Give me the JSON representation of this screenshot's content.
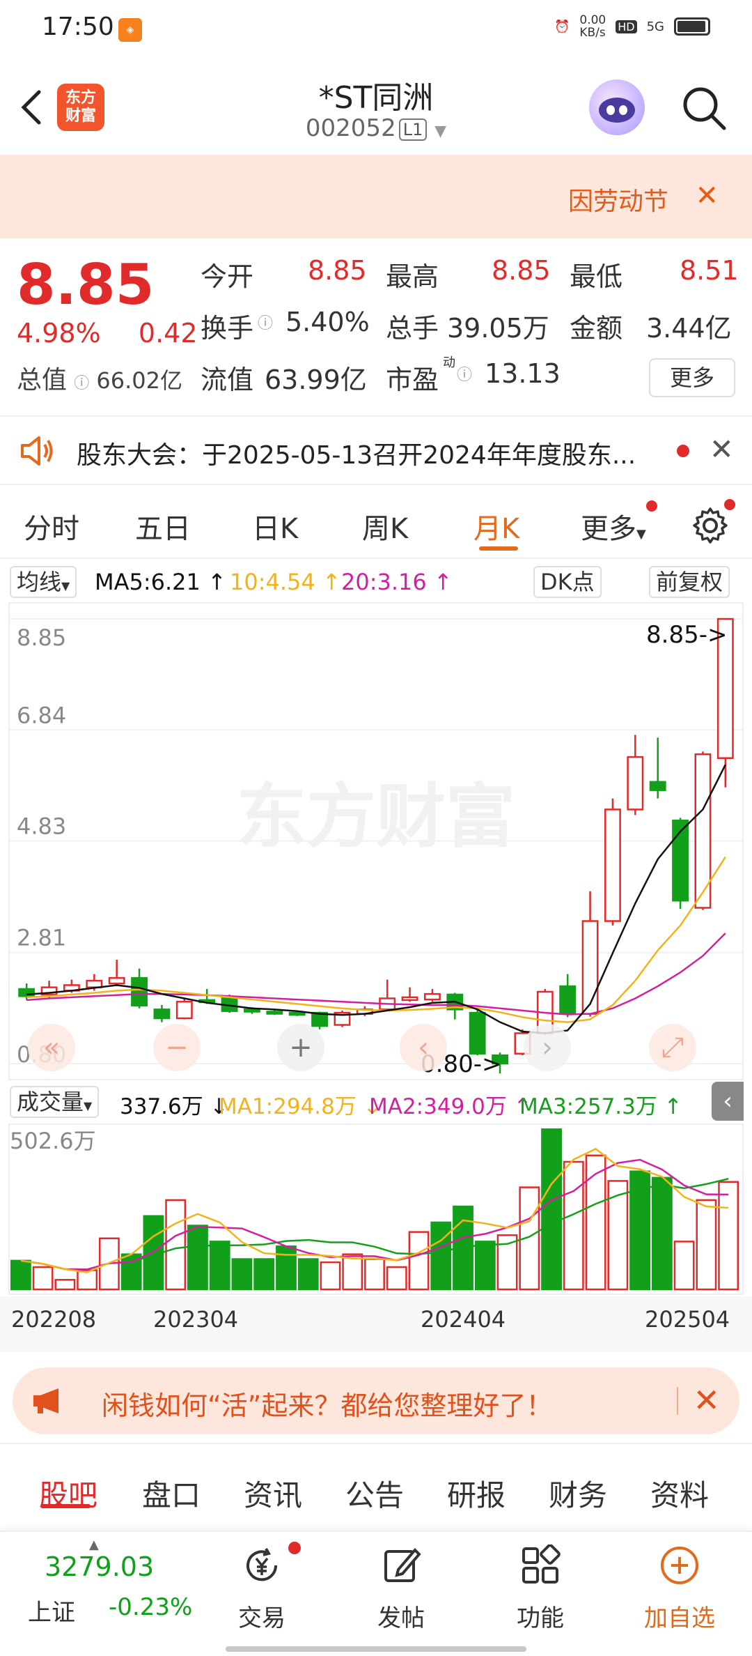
{
  "status": {
    "time": "17:50",
    "net": "0.00\nKB/s",
    "hd": "HD",
    "sig": "5G"
  },
  "header": {
    "title": "*ST同洲",
    "code": "002052",
    "code_badge": "L1",
    "logo": "东方\n财富"
  },
  "banner": {
    "text": "因劳动节"
  },
  "quote": {
    "price": "8.85",
    "change_pct": "4.98%",
    "change_abs": "0.42",
    "total_value_label": "总值",
    "total_value": "66.02亿",
    "rows": [
      [
        {
          "label": "今开",
          "value": "8.85",
          "red": true
        },
        {
          "label": "最高",
          "value": "8.85",
          "red": true
        },
        {
          "label": "最低",
          "value": "8.51",
          "red": true
        }
      ],
      [
        {
          "label": "换手",
          "value": "5.40%"
        },
        {
          "label": "总手",
          "value": "39.05万"
        },
        {
          "label": "金额",
          "value": "3.44亿"
        }
      ],
      [
        {
          "label": "流值",
          "value": "63.99亿"
        },
        {
          "label": "市盈",
          "value": "13.13"
        }
      ]
    ],
    "more_label": "更多",
    "pe_superscript": "动"
  },
  "notice": {
    "text": "股东大会：于2025-05-13召开2024年年度股东..."
  },
  "tabs": [
    "分时",
    "五日",
    "日K",
    "周K",
    "月K",
    "更多"
  ],
  "active_tab": "月K",
  "ma": {
    "chip": "均线",
    "ma5": "MA5:6.21 ↑",
    "ma10": "10:4.54 ↑",
    "ma20": "20:3.16 ↑",
    "dk": "DK点",
    "adjust": "前复权"
  },
  "colors": {
    "up": "#e12b2b",
    "down": "#12a01b",
    "ma5": "#111111",
    "ma10": "#f2b21a",
    "ma20": "#d21fa0",
    "accent": "#e26a1c"
  },
  "chart_data": {
    "type": "candlestick",
    "title": "",
    "y_ticks": [
      "8.85",
      "6.84",
      "4.83",
      "2.81",
      "0.80"
    ],
    "ylim": [
      0.8,
      8.85
    ],
    "last_label": "8.85->",
    "low_label": "0.80->",
    "candles": [
      {
        "o": 2.15,
        "c": 2.02,
        "h": 2.25,
        "l": 1.95
      },
      {
        "o": 2.05,
        "c": 2.18,
        "h": 2.3,
        "l": 1.98
      },
      {
        "o": 2.12,
        "c": 2.22,
        "h": 2.32,
        "l": 2.08
      },
      {
        "o": 2.18,
        "c": 2.3,
        "h": 2.42,
        "l": 2.12
      },
      {
        "o": 2.25,
        "c": 2.35,
        "h": 2.68,
        "l": 2.2
      },
      {
        "o": 2.35,
        "c": 1.85,
        "h": 2.52,
        "l": 1.8
      },
      {
        "o": 1.78,
        "c": 1.62,
        "h": 1.86,
        "l": 1.55
      },
      {
        "o": 1.62,
        "c": 1.92,
        "h": 1.98,
        "l": 1.6
      },
      {
        "o": 1.95,
        "c": 1.93,
        "h": 2.15,
        "l": 1.88
      },
      {
        "o": 1.98,
        "c": 1.75,
        "h": 2.05,
        "l": 1.72
      },
      {
        "o": 1.78,
        "c": 1.74,
        "h": 1.82,
        "l": 1.7
      },
      {
        "o": 1.74,
        "c": 1.72,
        "h": 1.78,
        "l": 1.68
      },
      {
        "o": 1.72,
        "c": 1.7,
        "h": 1.76,
        "l": 1.66
      },
      {
        "o": 1.72,
        "c": 1.48,
        "h": 1.74,
        "l": 1.42
      },
      {
        "o": 1.5,
        "c": 1.72,
        "h": 1.76,
        "l": 1.46
      },
      {
        "o": 1.7,
        "c": 1.78,
        "h": 1.84,
        "l": 1.66
      },
      {
        "o": 1.78,
        "c": 1.98,
        "h": 2.32,
        "l": 1.75
      },
      {
        "o": 1.95,
        "c": 2.0,
        "h": 2.18,
        "l": 1.92
      },
      {
        "o": 1.96,
        "c": 2.06,
        "h": 2.15,
        "l": 1.92
      },
      {
        "o": 2.05,
        "c": 1.78,
        "h": 2.08,
        "l": 1.6
      },
      {
        "o": 1.72,
        "c": 0.98,
        "h": 1.78,
        "l": 0.95
      },
      {
        "o": 0.95,
        "c": 0.8,
        "h": 1.0,
        "l": 0.62
      },
      {
        "o": 0.98,
        "c": 1.35,
        "h": 1.42,
        "l": 0.95
      },
      {
        "o": 1.35,
        "c": 2.1,
        "h": 2.15,
        "l": 1.32
      },
      {
        "o": 2.2,
        "c": 1.7,
        "h": 2.42,
        "l": 1.64
      },
      {
        "o": 1.7,
        "c": 3.38,
        "h": 3.92,
        "l": 1.65
      },
      {
        "o": 3.38,
        "c": 5.4,
        "h": 5.6,
        "l": 3.3
      },
      {
        "o": 5.4,
        "c": 6.35,
        "h": 6.75,
        "l": 5.3
      },
      {
        "o": 5.9,
        "c": 5.75,
        "h": 6.7,
        "l": 5.6
      },
      {
        "o": 5.2,
        "c": 3.75,
        "h": 5.25,
        "l": 3.6
      },
      {
        "o": 3.62,
        "c": 6.4,
        "h": 6.45,
        "l": 3.58
      },
      {
        "o": 6.33,
        "c": 8.85,
        "h": 8.85,
        "l": 5.8
      }
    ],
    "ma5": [
      2.05,
      2.08,
      2.12,
      2.17,
      2.22,
      2.17,
      2.06,
      1.98,
      1.9,
      1.85,
      1.8,
      1.78,
      1.75,
      1.7,
      1.68,
      1.7,
      1.76,
      1.82,
      1.9,
      1.92,
      1.78,
      1.55,
      1.38,
      1.35,
      1.4,
      1.88,
      2.8,
      3.7,
      4.5,
      5.0,
      5.4,
      6.21
    ],
    "ma10": [
      2.0,
      2.02,
      2.05,
      2.08,
      2.12,
      2.14,
      2.12,
      2.08,
      2.04,
      2.0,
      1.96,
      1.92,
      1.88,
      1.84,
      1.8,
      1.77,
      1.76,
      1.77,
      1.79,
      1.82,
      1.8,
      1.73,
      1.64,
      1.58,
      1.55,
      1.6,
      1.86,
      2.3,
      2.85,
      3.3,
      3.9,
      4.54
    ],
    "ma20": [
      1.95,
      1.98,
      2.0,
      2.02,
      2.04,
      2.06,
      2.06,
      2.05,
      2.04,
      2.02,
      2.0,
      1.98,
      1.96,
      1.94,
      1.92,
      1.9,
      1.88,
      1.87,
      1.86,
      1.86,
      1.84,
      1.8,
      1.76,
      1.72,
      1.69,
      1.7,
      1.8,
      1.98,
      2.2,
      2.45,
      2.75,
      3.16
    ]
  },
  "volume": {
    "chip": "成交量",
    "value": "337.6万 ↓",
    "ma1": "MA1:294.8万 ↓",
    "ma2": "MA2:349.0万 ↑",
    "ma3": "MA3:257.3万 ↑",
    "max_label": "502.6万",
    "ymax": 502.6,
    "bars": [
      90,
      70,
      30,
      60,
      160,
      110,
      230,
      280,
      200,
      150,
      95,
      95,
      135,
      95,
      85,
      110,
      95,
      70,
      180,
      210,
      260,
      150,
      170,
      320,
      502,
      400,
      420,
      340,
      370,
      350,
      150,
      280,
      337
    ]
  },
  "dates": [
    "202208",
    "202304",
    "202404",
    "202504"
  ],
  "chart_controls": {
    "rewind": "«",
    "zoom_out": "−",
    "zoom_in": "+",
    "prev": "‹",
    "next": "›",
    "fullscreen": "⤢"
  },
  "ad": {
    "text": "闲钱如何“活”起来？都给您整理好了！"
  },
  "sub_tabs": [
    "股吧",
    "盘口",
    "资讯",
    "公告",
    "研报",
    "财务",
    "资料"
  ],
  "bottom": {
    "index_value": "3279.03",
    "index_name": "上证",
    "index_change": "-0.23%",
    "nav": [
      "交易",
      "发帖",
      "功能",
      "加自选"
    ]
  }
}
